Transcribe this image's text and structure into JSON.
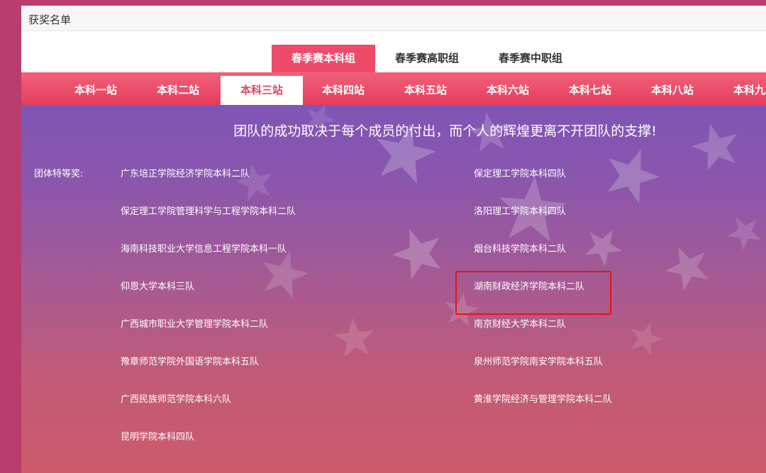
{
  "header": {
    "title": "获奖名单"
  },
  "group_tabs": [
    {
      "label": "春季赛本科组",
      "active": true
    },
    {
      "label": "春季赛高职组",
      "active": false
    },
    {
      "label": "春季赛中职组",
      "active": false
    }
  ],
  "station_tabs": [
    {
      "label": "本科一站",
      "active": false
    },
    {
      "label": "本科二站",
      "active": false
    },
    {
      "label": "本科三站",
      "active": true
    },
    {
      "label": "本科四站",
      "active": false
    },
    {
      "label": "本科五站",
      "active": false
    },
    {
      "label": "本科六站",
      "active": false
    },
    {
      "label": "本科七站",
      "active": false
    },
    {
      "label": "本科八站",
      "active": false
    },
    {
      "label": "本科九站",
      "active": false
    }
  ],
  "slogan": "团队的成功取决于每个成员的付出，而个人的辉煌更离不开团队的支撑!",
  "award": {
    "label": "团体特等奖:",
    "left_column": [
      "广东培正学院经济学院本科二队",
      "保定理工学院管理科学与工程学院本科二队",
      "海南科技职业大学信息工程学院本科一队",
      "仰恩大学本科三队",
      "广西城市职业大学管理学院本科二队",
      "豫章师范学院外国语学院本科五队",
      "广西民族师范学院本科六队",
      "昆明学院本科四队"
    ],
    "right_column": [
      "保定理工学院本科四队",
      "洛阳理工学院本科四队",
      "烟台科技学院本科二队",
      "湖南财政经济学院本科二队",
      "南京财经大学本科二队",
      "泉州师范学院南安学院本科五队",
      "黄淮学院经济与管理学院本科二队"
    ]
  },
  "colors": {
    "accent": "#ee4a6a",
    "station_bar": "#e94f6c",
    "highlight_box": "#e01818"
  }
}
